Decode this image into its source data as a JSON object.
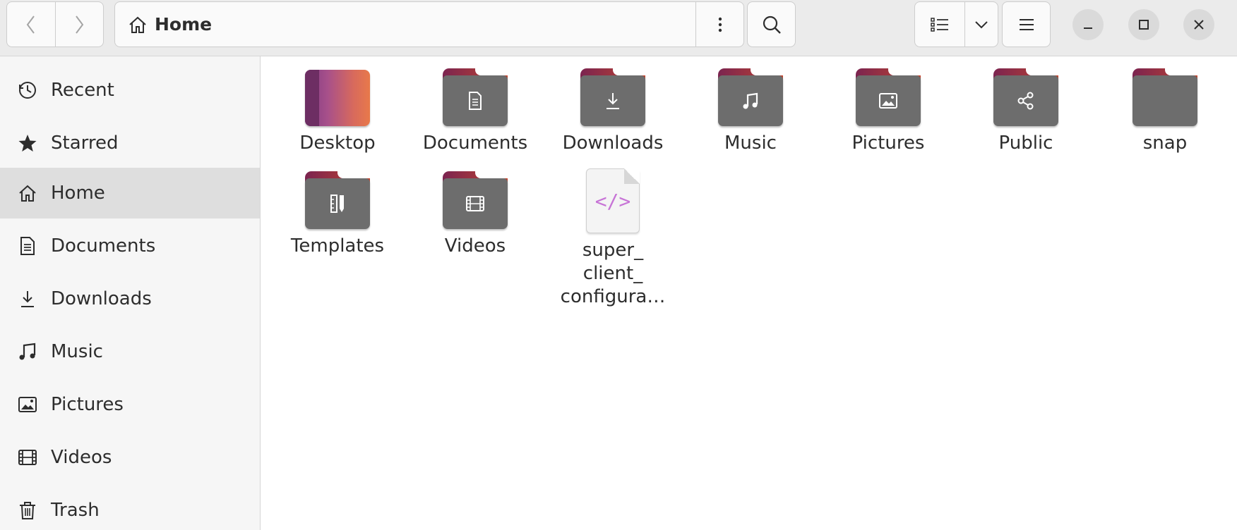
{
  "window": {
    "title": "Home",
    "controls": {
      "minimize": "minimize-icon",
      "maximize": "maximize-icon",
      "close": "close-icon"
    }
  },
  "toolbar": {
    "back_icon": "chevron-left-icon",
    "forward_icon": "chevron-right-icon",
    "path_label": "Home",
    "path_icon": "home-icon",
    "path_menu_icon": "vertical-dots-icon",
    "search_icon": "search-icon",
    "view_icon": "list-view-icon",
    "view_dropdown_icon": "chevron-down-icon",
    "main_menu_icon": "hamburger-icon"
  },
  "sidebar": {
    "items": [
      {
        "label": "Recent",
        "icon": "clock-icon",
        "active": false
      },
      {
        "label": "Starred",
        "icon": "star-icon",
        "active": false
      },
      {
        "label": "Home",
        "icon": "home-icon",
        "active": true
      },
      {
        "label": "Documents",
        "icon": "document-icon",
        "active": false
      },
      {
        "label": "Downloads",
        "icon": "download-icon",
        "active": false
      },
      {
        "label": "Music",
        "icon": "music-icon",
        "active": false
      },
      {
        "label": "Pictures",
        "icon": "picture-icon",
        "active": false
      },
      {
        "label": "Videos",
        "icon": "film-icon",
        "active": false
      },
      {
        "label": "Trash",
        "icon": "trash-icon",
        "active": false
      }
    ]
  },
  "content": {
    "items": [
      {
        "name": "Desktop",
        "type": "folder-desktop"
      },
      {
        "name": "Documents",
        "type": "folder",
        "emblem": "document-icon"
      },
      {
        "name": "Downloads",
        "type": "folder",
        "emblem": "download-icon"
      },
      {
        "name": "Music",
        "type": "folder",
        "emblem": "music-icon"
      },
      {
        "name": "Pictures",
        "type": "folder",
        "emblem": "picture-icon"
      },
      {
        "name": "Public",
        "type": "folder",
        "emblem": "share-icon"
      },
      {
        "name": "snap",
        "type": "folder"
      },
      {
        "name": "Templates",
        "type": "folder",
        "emblem": "template-icon"
      },
      {
        "name": "Videos",
        "type": "folder",
        "emblem": "film-icon"
      },
      {
        "name": "super_\nclient_\nconfigura…",
        "type": "file-code",
        "glyph": "</>"
      }
    ]
  },
  "colors": {
    "accent_folder_tab_start": "#7b2450",
    "accent_folder_tab_end": "#c2452e",
    "folder_body": "#6d6d6d",
    "code_glyph": "#c774d6",
    "sidebar_active": "#dedede",
    "headerbar": "#ebebeb"
  }
}
